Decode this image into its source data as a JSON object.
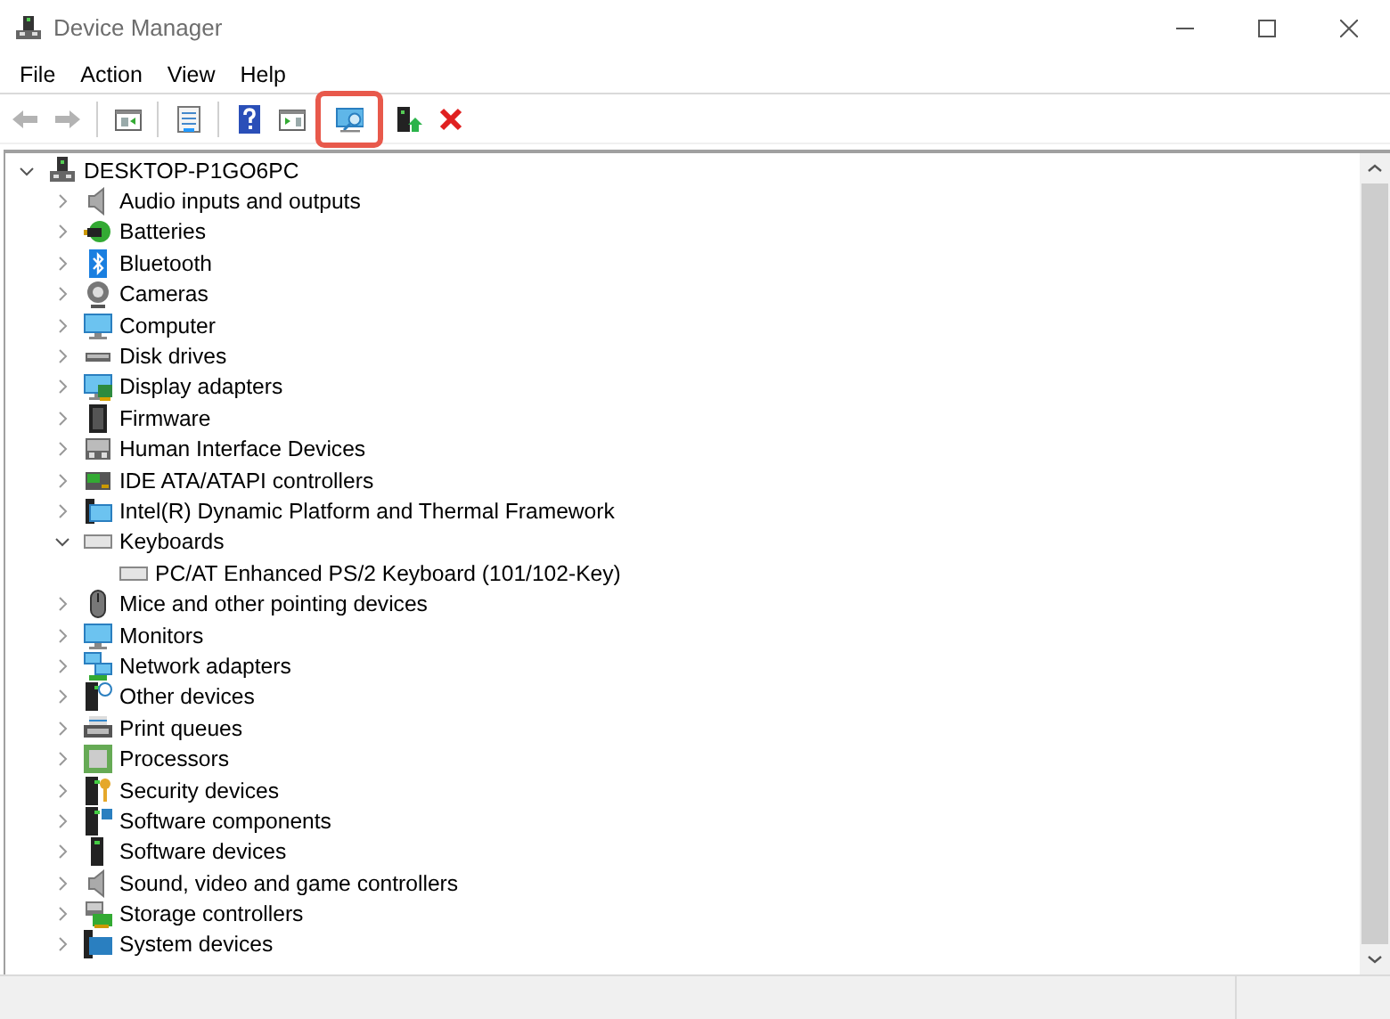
{
  "window": {
    "title": "Device Manager"
  },
  "menu": [
    "File",
    "Action",
    "View",
    "Help"
  ],
  "toolbar": [
    {
      "kind": "back",
      "disabled": true,
      "highlighted": false
    },
    {
      "kind": "forward",
      "disabled": true,
      "highlighted": false
    },
    {
      "kind": "separator"
    },
    {
      "kind": "console-tree",
      "disabled": false,
      "highlighted": false
    },
    {
      "kind": "separator"
    },
    {
      "kind": "properties",
      "disabled": false,
      "highlighted": false
    },
    {
      "kind": "separator"
    },
    {
      "kind": "help",
      "disabled": false,
      "highlighted": false
    },
    {
      "kind": "action-pane",
      "disabled": false,
      "highlighted": false
    },
    {
      "kind": "scan",
      "disabled": false,
      "highlighted": true
    },
    {
      "kind": "update",
      "disabled": false,
      "highlighted": false
    },
    {
      "kind": "uninstall",
      "disabled": false,
      "highlighted": false
    }
  ],
  "tree": {
    "label": "DESKTOP-P1GO6PC",
    "expanded": true,
    "children": [
      {
        "label": "Audio inputs and outputs",
        "expanded": false
      },
      {
        "label": "Batteries",
        "expanded": false
      },
      {
        "label": "Bluetooth",
        "expanded": false
      },
      {
        "label": "Cameras",
        "expanded": false
      },
      {
        "label": "Computer",
        "expanded": false
      },
      {
        "label": "Disk drives",
        "expanded": false
      },
      {
        "label": "Display adapters",
        "expanded": false
      },
      {
        "label": "Firmware",
        "expanded": false
      },
      {
        "label": "Human Interface Devices",
        "expanded": false
      },
      {
        "label": "IDE ATA/ATAPI controllers",
        "expanded": false
      },
      {
        "label": "Intel(R) Dynamic Platform and Thermal Framework",
        "expanded": false
      },
      {
        "label": "Keyboards",
        "expanded": true,
        "children": [
          {
            "label": "PC/AT Enhanced PS/2 Keyboard (101/102-Key)"
          }
        ]
      },
      {
        "label": "Mice and other pointing devices",
        "expanded": false
      },
      {
        "label": "Monitors",
        "expanded": false
      },
      {
        "label": "Network adapters",
        "expanded": false
      },
      {
        "label": "Other devices",
        "expanded": false
      },
      {
        "label": "Print queues",
        "expanded": false
      },
      {
        "label": "Processors",
        "expanded": false
      },
      {
        "label": "Security devices",
        "expanded": false
      },
      {
        "label": "Software components",
        "expanded": false
      },
      {
        "label": "Software devices",
        "expanded": false
      },
      {
        "label": "Sound, video and game controllers",
        "expanded": false
      },
      {
        "label": "Storage controllers",
        "expanded": false
      },
      {
        "label": "System devices",
        "expanded": false
      }
    ]
  }
}
